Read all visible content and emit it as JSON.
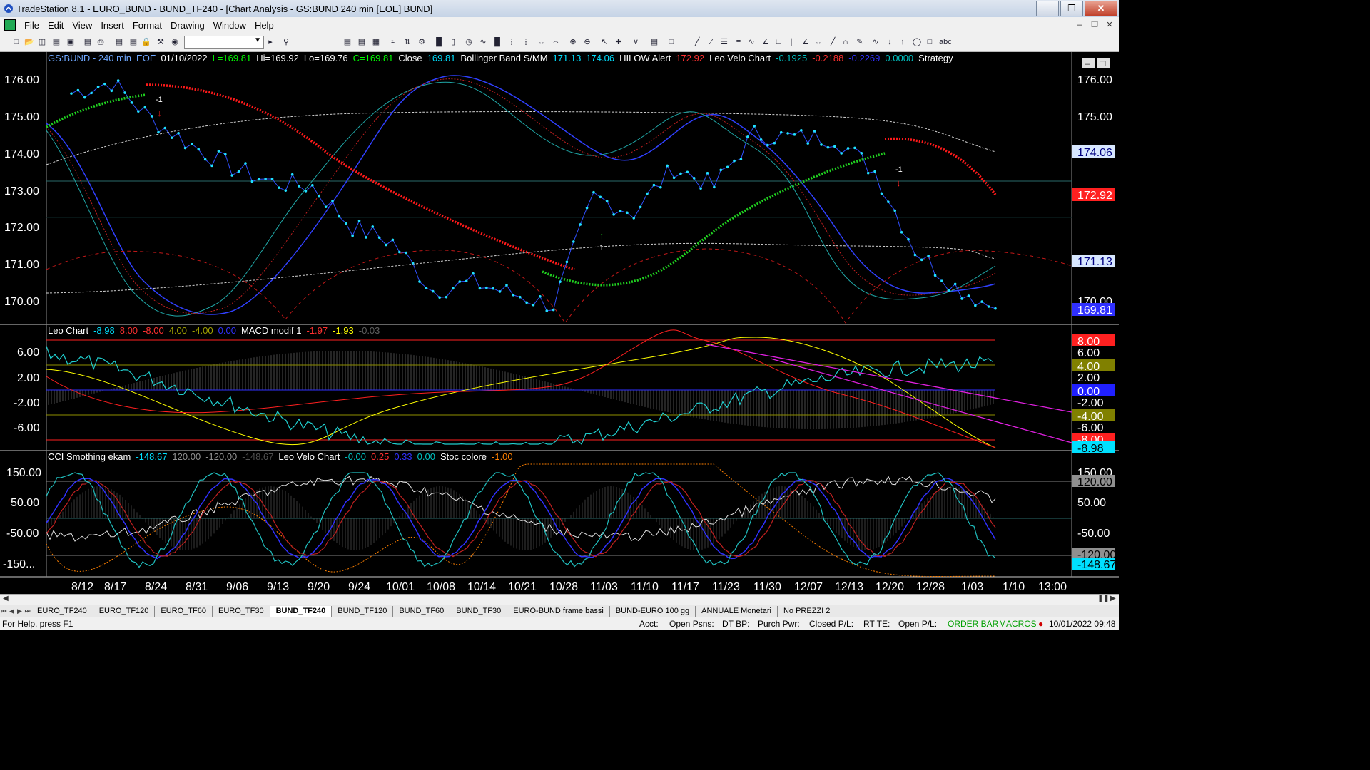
{
  "window": {
    "title": "TradeStation 8.1 - EURO_BUND - BUND_TF240 - [Chart Analysis - GS:BUND  240 min  [EOE] BUND]"
  },
  "menu": [
    "File",
    "Edit",
    "View",
    "Insert",
    "Format",
    "Drawing",
    "Window",
    "Help"
  ],
  "main_pane": {
    "legend": [
      {
        "text": "GS:BUND - 240 min",
        "color": "#6fa8ff"
      },
      {
        "text": "EOE",
        "color": "#6fa8ff"
      },
      {
        "text": "01/10/2022",
        "color": "#ffffff"
      },
      {
        "text": "L=169.81",
        "color": "#00ff00"
      },
      {
        "text": "Hi=169.92",
        "color": "#ffffff"
      },
      {
        "text": "Lo=169.76",
        "color": "#ffffff"
      },
      {
        "text": "C=169.81",
        "color": "#00ff00"
      },
      {
        "text": "Close",
        "color": "#ffffff"
      },
      {
        "text": "169.81",
        "color": "#00e0ff"
      },
      {
        "text": "Bollinger Band S/MM",
        "color": "#ffffff"
      },
      {
        "text": "171.13",
        "color": "#00e0ff"
      },
      {
        "text": "174.06",
        "color": "#00e0ff"
      },
      {
        "text": "HILOW Alert",
        "color": "#ffffff"
      },
      {
        "text": "172.92",
        "color": "#ff3030"
      },
      {
        "text": "Leo Velo Chart",
        "color": "#ffffff"
      },
      {
        "text": "-0.1925",
        "color": "#00c0c0"
      },
      {
        "text": "-0.2188",
        "color": "#ff3030"
      },
      {
        "text": "-0.2269",
        "color": "#3030ff"
      },
      {
        "text": "0.0000",
        "color": "#00c0c0"
      },
      {
        "text": "Strategy",
        "color": "#ffffff"
      }
    ],
    "axis_labels": [
      "176.00",
      "175.00",
      "174.00",
      "173.00",
      "172.00",
      "171.00",
      "170.00"
    ],
    "price_tags": [
      {
        "text": "174.06",
        "bg": "#d8e8ff",
        "fg": "#000080"
      },
      {
        "text": "172.92",
        "bg": "#ff2020",
        "fg": "#ffffff"
      },
      {
        "text": "171.13",
        "bg": "#d8e8ff",
        "fg": "#000080"
      },
      {
        "text": "169.81",
        "bg": "#3030ff",
        "fg": "#ffffff"
      }
    ],
    "signals": [
      {
        "text": "-1",
        "dir": "down"
      },
      {
        "text": "1",
        "dir": "up"
      },
      {
        "text": "-1",
        "dir": "down"
      }
    ]
  },
  "mid_pane": {
    "legend": [
      {
        "text": "Leo Chart",
        "color": "#ffffff"
      },
      {
        "text": "-8.98",
        "color": "#00e0ff"
      },
      {
        "text": "8.00",
        "color": "#ff3030"
      },
      {
        "text": "-8.00",
        "color": "#ff3030"
      },
      {
        "text": "4.00",
        "color": "#a0a000"
      },
      {
        "text": "-4.00",
        "color": "#a0a000"
      },
      {
        "text": "0.00",
        "color": "#3030ff"
      },
      {
        "text": "MACD modif 1",
        "color": "#ffffff"
      },
      {
        "text": "-1.97",
        "color": "#ff3030"
      },
      {
        "text": "-1.93",
        "color": "#ffff00"
      },
      {
        "text": "-0.03",
        "color": "#606060"
      }
    ],
    "axis_labels": [
      "6.00",
      "2.00",
      "-2.00",
      "-6.00"
    ],
    "tags": [
      {
        "text": "8.00",
        "bg": "#ff2020",
        "fg": "#ffffff"
      },
      {
        "text": "6.00",
        "bg": "#000000",
        "fg": "#ffffff"
      },
      {
        "text": "4.00",
        "bg": "#808000",
        "fg": "#ffffff"
      },
      {
        "text": "2.00",
        "bg": "#000000",
        "fg": "#ffffff"
      },
      {
        "text": "0.00",
        "bg": "#2020ff",
        "fg": "#ffffff"
      },
      {
        "text": "-2.00",
        "bg": "#000000",
        "fg": "#ffffff"
      },
      {
        "text": "-4.00",
        "bg": "#808000",
        "fg": "#ffffff"
      },
      {
        "text": "-6.00",
        "bg": "#000000",
        "fg": "#ffffff"
      },
      {
        "text": "-8.00",
        "bg": "#ff2020",
        "fg": "#ffffff"
      },
      {
        "text": "-8.98",
        "bg": "#00e0ff",
        "fg": "#000000"
      }
    ]
  },
  "low_pane": {
    "legend": [
      {
        "text": "CCI Smothing ekam",
        "color": "#ffffff"
      },
      {
        "text": "-148.67",
        "color": "#00e0ff"
      },
      {
        "text": "120.00",
        "color": "#909090"
      },
      {
        "text": "-120.00",
        "color": "#909090"
      },
      {
        "text": "-148.67",
        "color": "#505050"
      },
      {
        "text": "Leo Velo Chart",
        "color": "#ffffff"
      },
      {
        "text": "-0.00",
        "color": "#00c0c0"
      },
      {
        "text": "0.25",
        "color": "#ff3030"
      },
      {
        "text": "0.33",
        "color": "#3030ff"
      },
      {
        "text": "0.00",
        "color": "#00c0c0"
      },
      {
        "text": "Stoc colore",
        "color": "#ffffff"
      },
      {
        "text": "-1.00",
        "color": "#ff8000"
      }
    ],
    "axis_labels": [
      "150.00",
      "50.00",
      "-50.00",
      "-150..."
    ],
    "tags": [
      {
        "text": "150.00",
        "bg": "#000000",
        "fg": "#ffffff"
      },
      {
        "text": "120.00",
        "bg": "#909090",
        "fg": "#000000"
      },
      {
        "text": "50.00",
        "bg": "#000000",
        "fg": "#ffffff"
      },
      {
        "text": "-50.00",
        "bg": "#000000",
        "fg": "#ffffff"
      },
      {
        "text": "-120.00",
        "bg": "#909090",
        "fg": "#000000"
      },
      {
        "text": "-148.67",
        "bg": "#00e0ff",
        "fg": "#000000"
      }
    ]
  },
  "date_axis": [
    "8/12",
    "8/17",
    "8/24",
    "8/31",
    "9/06",
    "9/13",
    "9/20",
    "9/24",
    "10/01",
    "10/08",
    "10/14",
    "10/21",
    "10/28",
    "11/03",
    "11/10",
    "11/17",
    "11/23",
    "11/30",
    "12/07",
    "12/13",
    "12/20",
    "12/28",
    "1/03",
    "1/10",
    "13:00"
  ],
  "sheet_tabs": [
    "EURO_TF240",
    "EURO_TF120",
    "EURO_TF60",
    "EURO_TF30",
    "BUND_TF240",
    "BUND_TF120",
    "BUND_TF60",
    "BUND_TF30",
    "EURO-BUND frame bassi",
    "BUND-EURO 100 gg",
    "ANNUALE Monetari",
    "No PREZZI 2"
  ],
  "active_tab": "BUND_TF240",
  "status": {
    "help": "For Help, press F1",
    "acct": "Acct:",
    "open_psns": "Open Psns:",
    "dt_bp": "DT BP:",
    "purch_pwr": "Purch Pwr:",
    "closed_pl": "Closed P/L:",
    "rt_te": "RT TE:",
    "open_pl": "Open P/L:",
    "order_bar": "ORDER BAR",
    "macros": "MACROS",
    "datetime": "10/01/2022 09:48"
  },
  "chart_data": {
    "type": "line",
    "title": "GS:BUND - 240 min",
    "x": [
      "8/12",
      "8/17",
      "8/24",
      "8/31",
      "9/06",
      "9/13",
      "9/20",
      "9/24",
      "10/01",
      "10/08",
      "10/14",
      "10/21",
      "10/28",
      "11/03",
      "11/10",
      "11/17",
      "11/23",
      "11/30",
      "12/07",
      "12/13",
      "12/20",
      "12/28",
      "1/03",
      "1/10"
    ],
    "series": [
      {
        "name": "Close",
        "values": [
          175.6,
          175.9,
          174.9,
          174.2,
          173.6,
          173.2,
          173.1,
          172.0,
          171.6,
          170.3,
          170.5,
          170.2,
          169.9,
          172.8,
          172.4,
          173.6,
          173.1,
          174.5,
          174.4,
          174.4,
          173.5,
          171.4,
          170.4,
          169.81
        ]
      },
      {
        "name": "HILOW Alert",
        "values": [
          175.8,
          175.7,
          175.3,
          174.8,
          174.2,
          173.7,
          173.2,
          172.6,
          172.0,
          171.5,
          171.1,
          170.9,
          170.7,
          170.6,
          170.9,
          171.7,
          172.6,
          173.3,
          173.8,
          174.1,
          174.4,
          174.1,
          173.4,
          172.92
        ]
      }
    ],
    "ylim": [
      169.6,
      176.4
    ]
  }
}
